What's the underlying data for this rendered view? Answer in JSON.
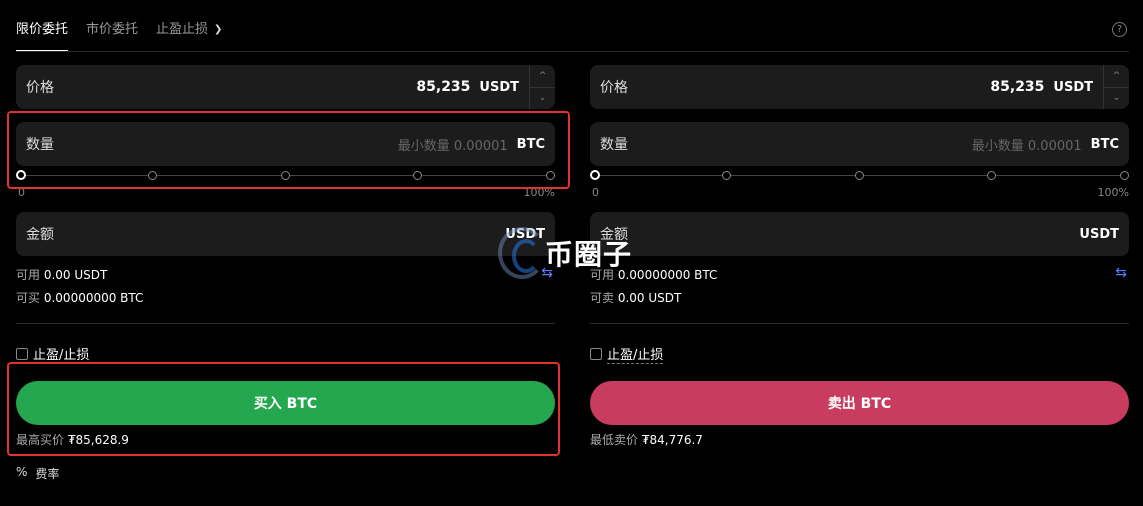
{
  "tabs": {
    "limit": "限价委托",
    "market": "市价委托",
    "tpsl": "止盈止损"
  },
  "help_icon": "?",
  "buy": {
    "price_label": "价格",
    "price_value": "85,235",
    "price_unit": "USDT",
    "qty_label": "数量",
    "qty_placeholder": "最小数量 0.00001",
    "qty_unit": "BTC",
    "slider_min": "0",
    "slider_max": "100%",
    "slider_value": 0,
    "amount_label": "金额",
    "amount_unit": "USDT",
    "avail_label": "可用",
    "avail_value": "0.00 USDT",
    "can_label": "可买",
    "can_value": "0.00000000 BTC",
    "tpsl_label": "止盈/止损",
    "button": "买入 BTC",
    "best_label": "最高买价",
    "best_value": "₮85,628.9"
  },
  "sell": {
    "price_label": "价格",
    "price_value": "85,235",
    "price_unit": "USDT",
    "qty_label": "数量",
    "qty_placeholder": "最小数量 0.00001",
    "qty_unit": "BTC",
    "slider_min": "0",
    "slider_max": "100%",
    "slider_value": 0,
    "amount_label": "金额",
    "amount_unit": "USDT",
    "avail_label": "可用",
    "avail_value": "0.00000000 BTC",
    "can_label": "可卖",
    "can_value": "0.00 USDT",
    "tpsl_label": "止盈/止损",
    "button": "卖出 BTC",
    "best_label": "最低卖价",
    "best_value": "₮84,776.7"
  },
  "fee": {
    "icon": "%",
    "label": "费率"
  },
  "watermark": "币圈子",
  "colors": {
    "buy": "#25a750",
    "sell": "#c83d5f",
    "highlight": "#e0332e",
    "swap_icon": "#5b7cff"
  }
}
